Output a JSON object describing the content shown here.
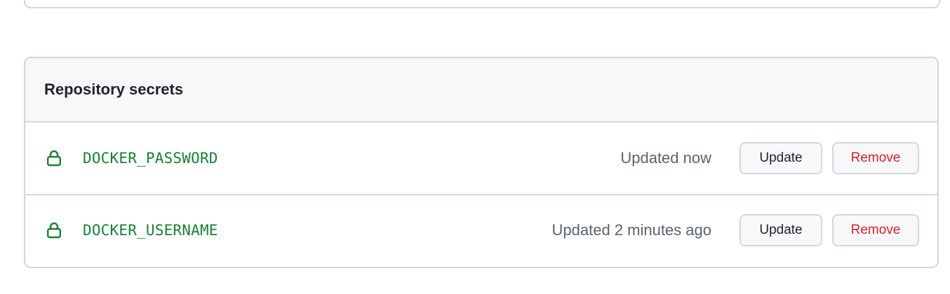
{
  "section": {
    "title": "Repository secrets"
  },
  "secrets": [
    {
      "name": "DOCKER_PASSWORD",
      "updated": "Updated now",
      "update_label": "Update",
      "remove_label": "Remove",
      "icon": "lock-icon"
    },
    {
      "name": "DOCKER_USERNAME",
      "updated": "Updated 2 minutes ago",
      "update_label": "Update",
      "remove_label": "Remove",
      "icon": "lock-icon"
    }
  ],
  "colors": {
    "secret_name": "#1a7f37",
    "danger": "#d1242f",
    "border": "#d0d7de",
    "header_bg": "#f6f8fa"
  }
}
